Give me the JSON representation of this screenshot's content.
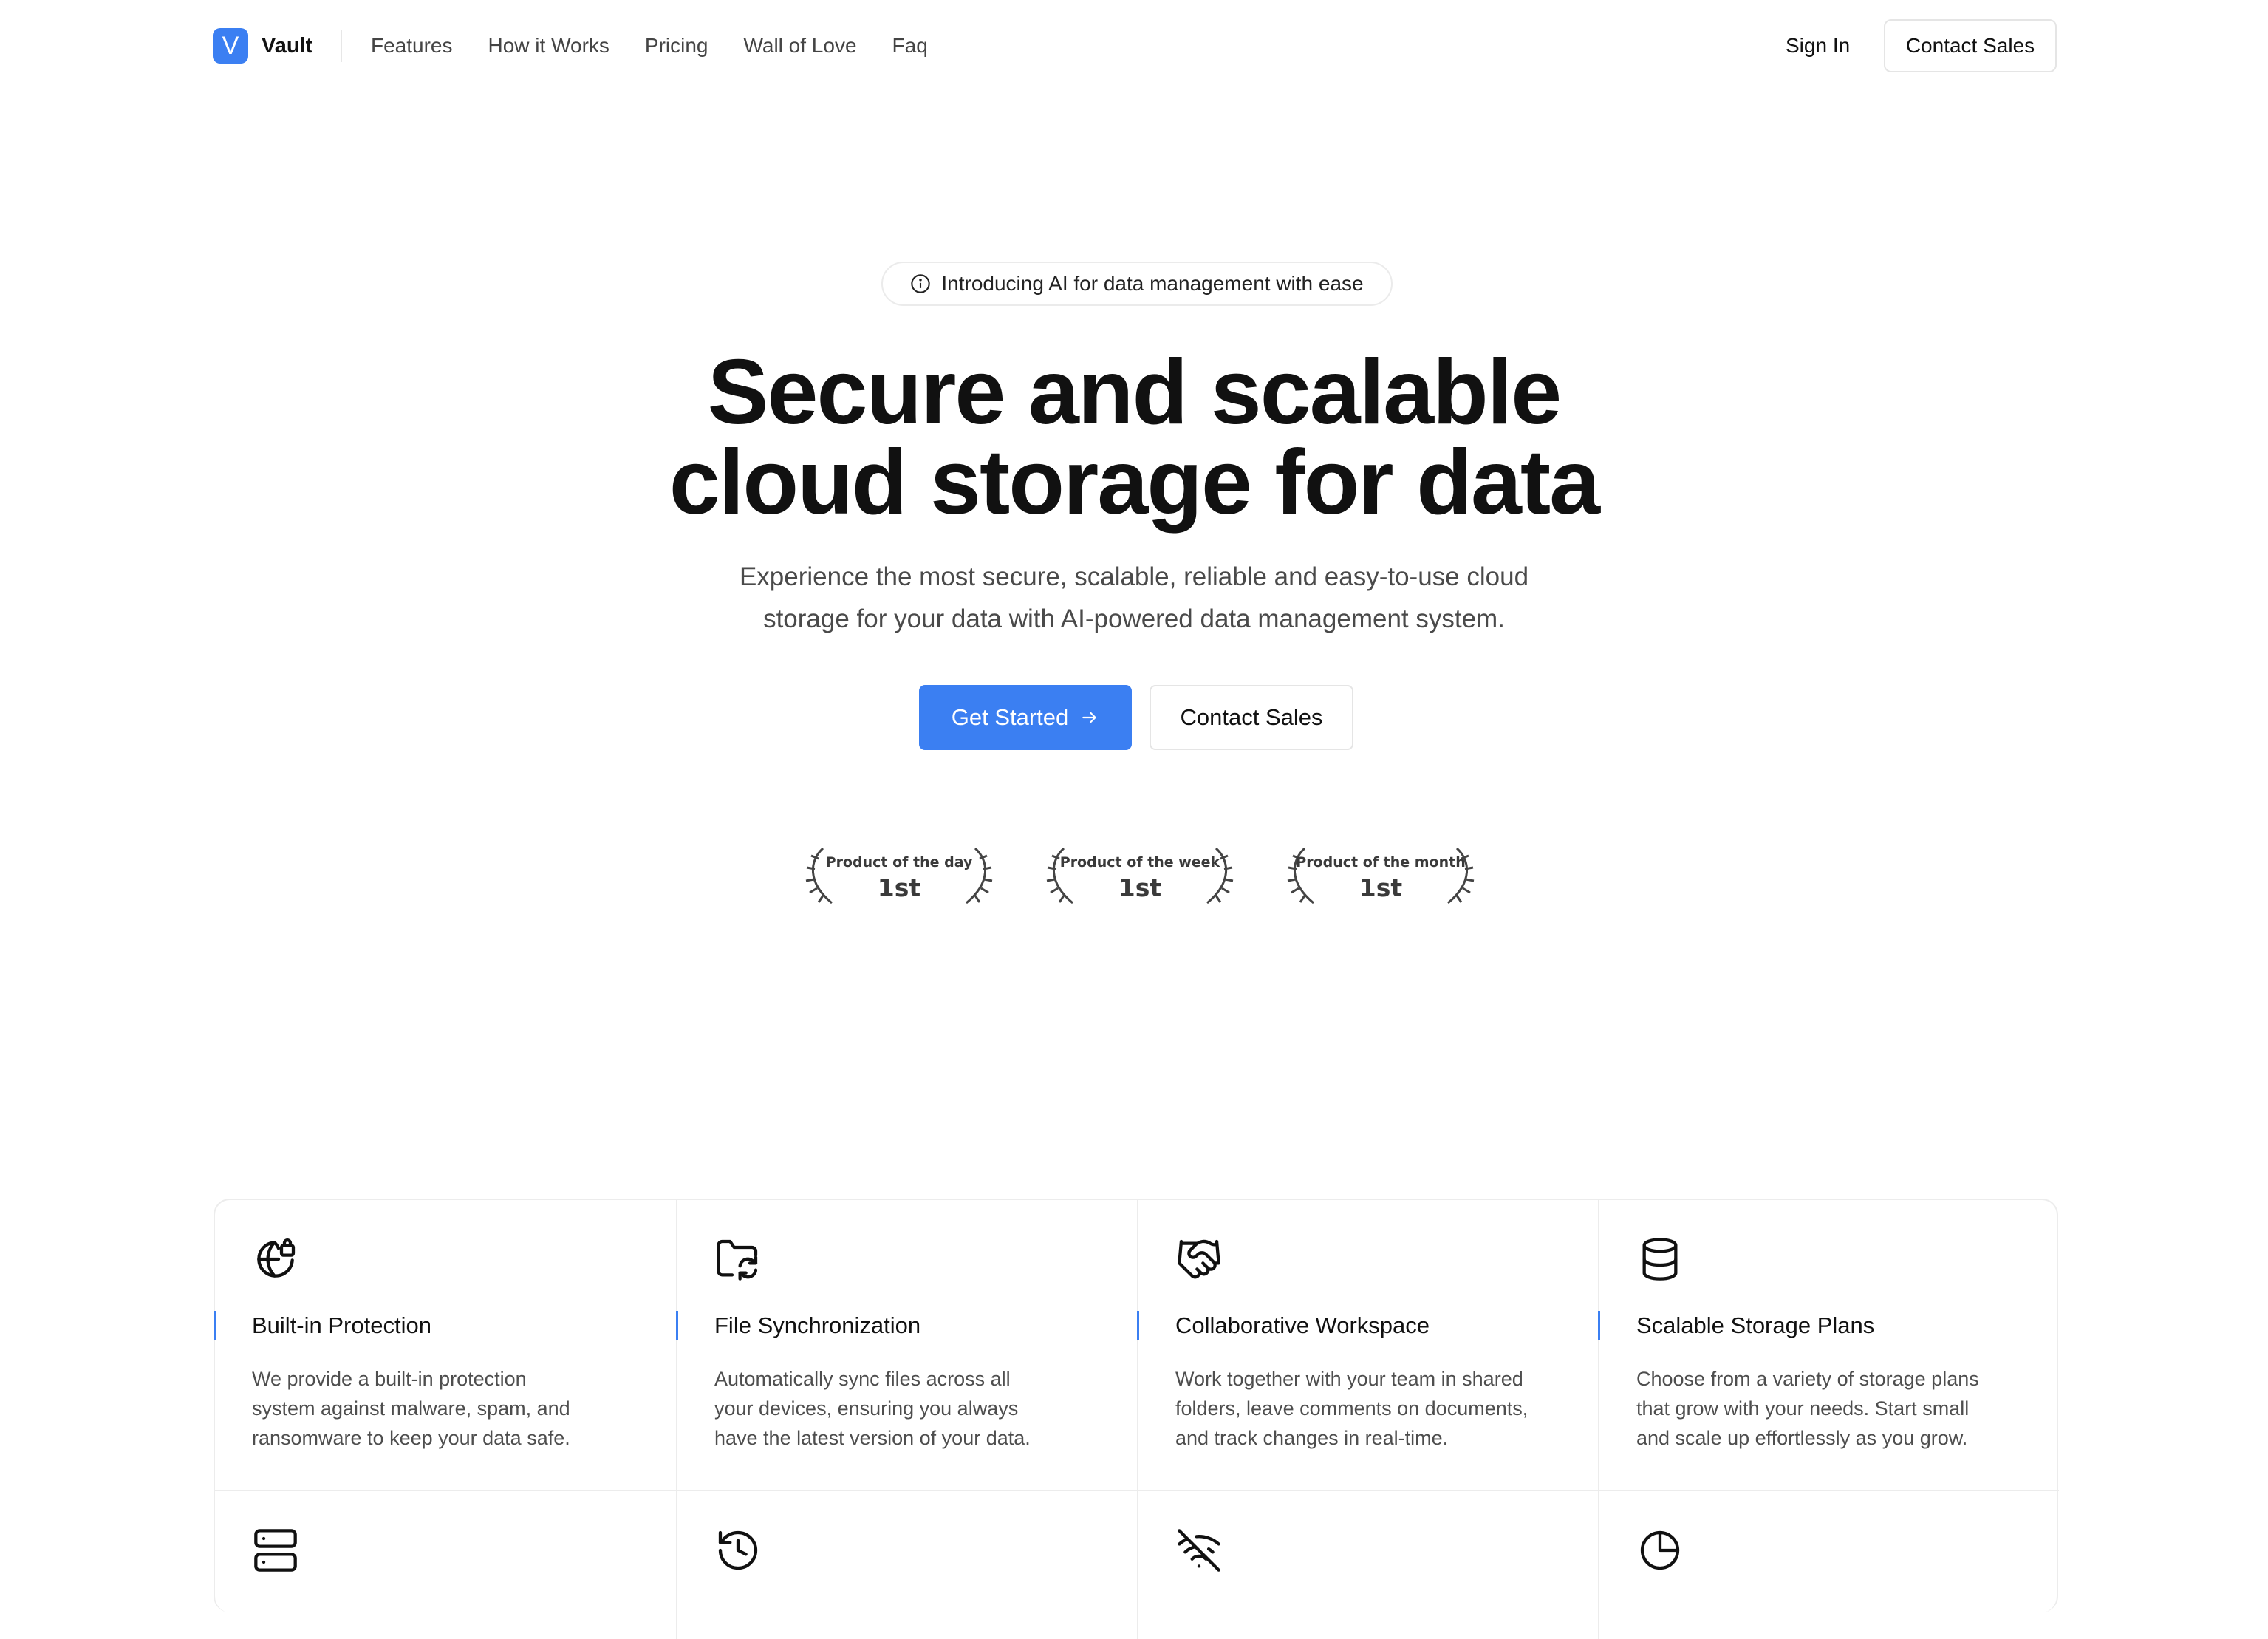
{
  "brand": {
    "logo_letter": "V",
    "name": "Vault",
    "accent": "#3b7ff2"
  },
  "nav": {
    "links": [
      "Features",
      "How it Works",
      "Pricing",
      "Wall of Love",
      "Faq"
    ],
    "sign_in": "Sign In",
    "contact_sales": "Contact Sales"
  },
  "hero": {
    "announcement": "Introducing AI for data management with ease",
    "announcement_icon": "info-icon",
    "title_line1": "Secure and scalable",
    "title_line2": "cloud storage for data",
    "subtitle_line1": "Experience the most secure, scalable, reliable and easy-to-use cloud",
    "subtitle_line2": "storage for your data with AI-powered data management system.",
    "primary_cta": "Get Started",
    "primary_cta_icon": "arrow-right-icon",
    "secondary_cta": "Contact Sales"
  },
  "awards": [
    {
      "label": "Product of the day",
      "rank": "1st"
    },
    {
      "label": "Product of the week",
      "rank": "1st"
    },
    {
      "label": "Product of the month",
      "rank": "1st"
    }
  ],
  "features": [
    {
      "icon": "globe-lock-icon",
      "title": "Built-in Protection",
      "desc": [
        "We provide a built-in protection",
        "system against malware, spam, and",
        "ransomware to keep your data safe."
      ]
    },
    {
      "icon": "folder-sync-icon",
      "title": "File Synchronization",
      "desc": [
        "Automatically sync files across all",
        "your devices, ensuring you always",
        "have the latest version of your data."
      ]
    },
    {
      "icon": "handshake-icon",
      "title": "Collaborative Workspace",
      "desc": [
        "Work together with your team in shared",
        "folders, leave comments on documents,",
        "and track changes in real-time."
      ]
    },
    {
      "icon": "database-icon",
      "title": "Scalable Storage Plans",
      "desc": [
        "Choose from a variety of storage plans",
        "that grow with your needs. Start small",
        "and scale up effortlessly as you grow."
      ]
    },
    {
      "icon": "server-icon"
    },
    {
      "icon": "history-icon"
    },
    {
      "icon": "wifi-off-icon"
    },
    {
      "icon": "pie-chart-icon"
    }
  ]
}
